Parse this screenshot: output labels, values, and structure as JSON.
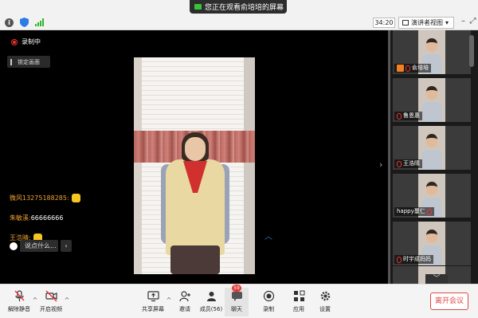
{
  "banner": {
    "text": "您正在观看俞培培的屏幕"
  },
  "header": {
    "timer": "34:20",
    "view_mode": "演讲者视图",
    "icons": [
      "info-icon",
      "shield-icon",
      "signal-icon"
    ]
  },
  "main": {
    "recording_label": "录制中",
    "lock_label": "锁定画面"
  },
  "chat": {
    "messages": [
      {
        "name": "微风13275188285:",
        "text": ""
      },
      {
        "name": "朱敏溪:",
        "text": "66666666"
      },
      {
        "name": "王浩晴:",
        "text": ""
      }
    ],
    "input_placeholder": "说点什么..."
  },
  "gallery": {
    "participants": [
      {
        "name": "俞培培"
      },
      {
        "name": "鲁恩惠"
      },
      {
        "name": "王浩晴"
      },
      {
        "name": "happy蔓仁"
      },
      {
        "name": "时宇成妈妈"
      }
    ]
  },
  "toolbar": {
    "unmute": "解除静音",
    "start_video": "开启视频",
    "share_screen": "共享屏幕",
    "invite": "邀请",
    "members": "成员(56)",
    "chat": "聊天",
    "chat_badge": "59",
    "record": "录制",
    "apps": "应用",
    "settings": "设置",
    "leave": "离开会议"
  },
  "colors": {
    "accent": "#3a7bd5",
    "leave": "#e04848",
    "chat_name": "#f0a030",
    "recording": "#e33333"
  }
}
